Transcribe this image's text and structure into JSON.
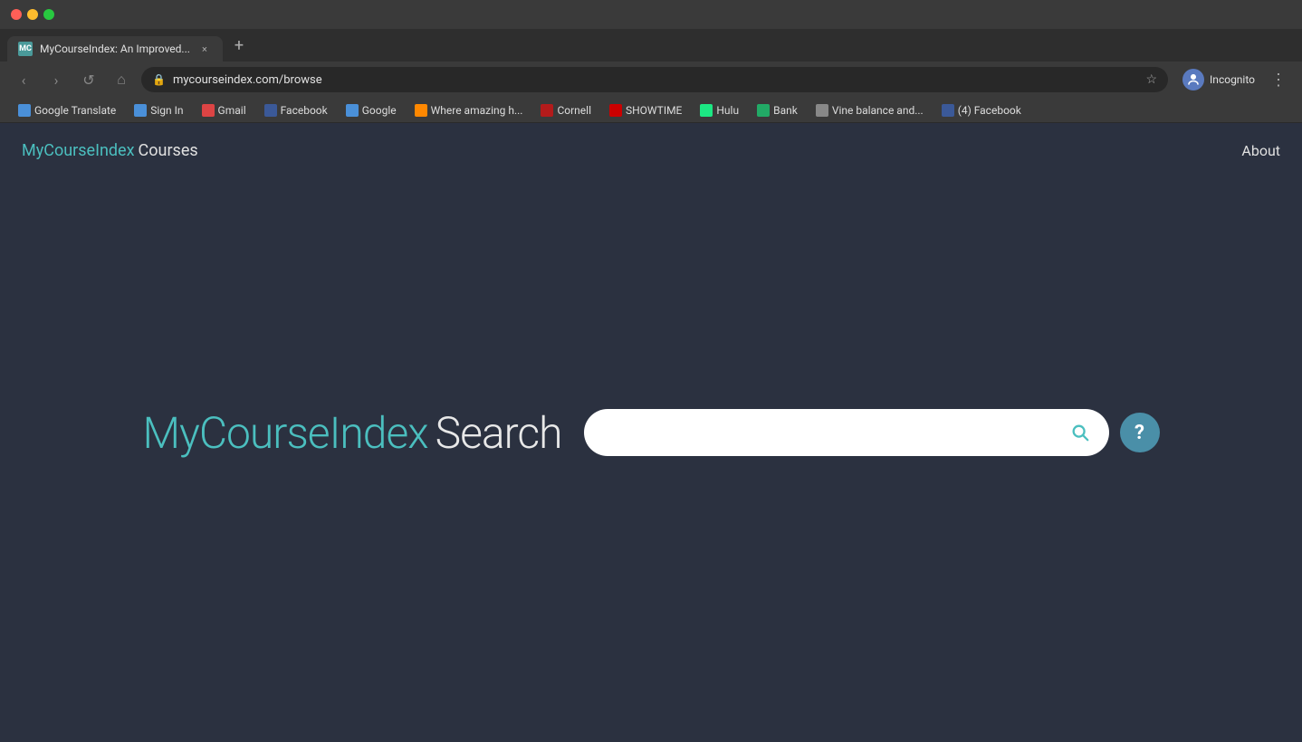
{
  "browser": {
    "traffic_lights": [
      "close",
      "minimize",
      "maximize"
    ],
    "tab": {
      "favicon_text": "MC",
      "title": "MyCourseIndex: An Improved...",
      "close_symbol": "×"
    },
    "new_tab_symbol": "+",
    "nav_back_symbol": "‹",
    "nav_forward_symbol": "›",
    "nav_reload_symbol": "↺",
    "nav_home_symbol": "⌂",
    "address": "mycourseindex.com/browse",
    "star_symbol": "☆",
    "profile_label": "Incognito",
    "menu_symbol": "⋮",
    "bookmarks": [
      {
        "label": "Google Translate",
        "color": "#4a90d9"
      },
      {
        "label": "Sign In",
        "color": "#4a90d9"
      },
      {
        "label": "Gmail",
        "color": "#d44"
      },
      {
        "label": "Facebook",
        "color": "#3b5998"
      },
      {
        "label": "Google",
        "color": "#4a90d9"
      },
      {
        "label": "Where amazing h...",
        "color": "#f80"
      },
      {
        "label": "Cornell",
        "color": "#b31b1b"
      },
      {
        "label": "SHOWTIME",
        "color": "#c00"
      },
      {
        "label": "Hulu",
        "color": "#1ce783"
      },
      {
        "label": "Bank",
        "color": "#2a6"
      },
      {
        "label": "Vine balance and...",
        "color": "#888"
      },
      {
        "label": "(4) Facebook",
        "color": "#3b5998"
      }
    ]
  },
  "app": {
    "nav": {
      "brand_my_course_index": "MyCourseIndex",
      "brand_courses": "Courses",
      "about_label": "About"
    },
    "hero": {
      "title_brand": "MyCourseIndex",
      "title_search": "Search",
      "search_placeholder": "",
      "help_symbol": "?"
    }
  }
}
